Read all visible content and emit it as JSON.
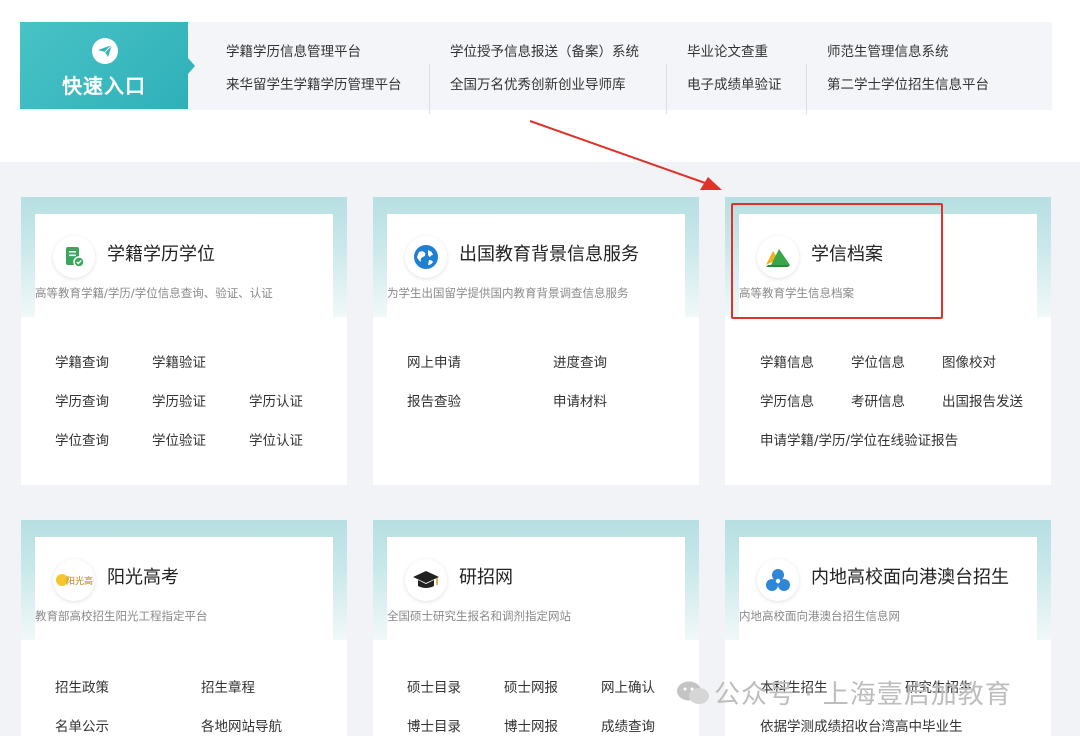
{
  "quick_entry": {
    "label": "快速入口",
    "links": [
      "学籍学历信息管理平台",
      "来华留学生学籍学历管理平台",
      "学位授予信息报送（备案）系统",
      "全国万名优秀创新创业导师库",
      "毕业论文查重",
      "电子成绩单验证",
      "师范生管理信息系统",
      "第二学士学位招生信息平台"
    ]
  },
  "cards": [
    {
      "title": "学籍学历学位",
      "subtitle": "高等教育学籍/学历/学位信息查询、验证、认证",
      "links": [
        "学籍查询",
        "学籍验证",
        "学历查询",
        "学历验证",
        "学历认证",
        "学位查询",
        "学位验证",
        "学位认证"
      ]
    },
    {
      "title": "出国教育背景信息服务",
      "subtitle": "为学生出国留学提供国内教育背景调查信息服务",
      "links": [
        "网上申请",
        "进度查询",
        "报告查验",
        "申请材料"
      ]
    },
    {
      "title": "学信档案",
      "subtitle": "高等教育学生信息档案",
      "links": [
        "学籍信息",
        "学位信息",
        "图像校对",
        "学历信息",
        "考研信息",
        "出国报告发送",
        "申请学籍/学历/学位在线验证报告"
      ]
    },
    {
      "title": "阳光高考",
      "subtitle": "教育部高校招生阳光工程指定平台",
      "logo_text": "阳光高考",
      "links": [
        "招生政策",
        "招生章程",
        "名单公示",
        "各地网站导航"
      ]
    },
    {
      "title": "研招网",
      "subtitle": "全国硕士研究生报名和调剂指定网站",
      "links": [
        "硕士目录",
        "硕士网报",
        "网上确认",
        "博士目录",
        "博士网报",
        "成绩查询"
      ]
    },
    {
      "title": "内地高校面向港澳台招生",
      "subtitle": "内地高校面向港澳台招生信息网",
      "links": [
        "本科生招生",
        "研究生招生",
        "依据学测成绩招收台湾高中毕业生"
      ]
    }
  ],
  "watermark": "公众号 · 上海壹启加教育",
  "colors": {
    "accent": "#3bb8be",
    "highlight": "#e0312b"
  }
}
